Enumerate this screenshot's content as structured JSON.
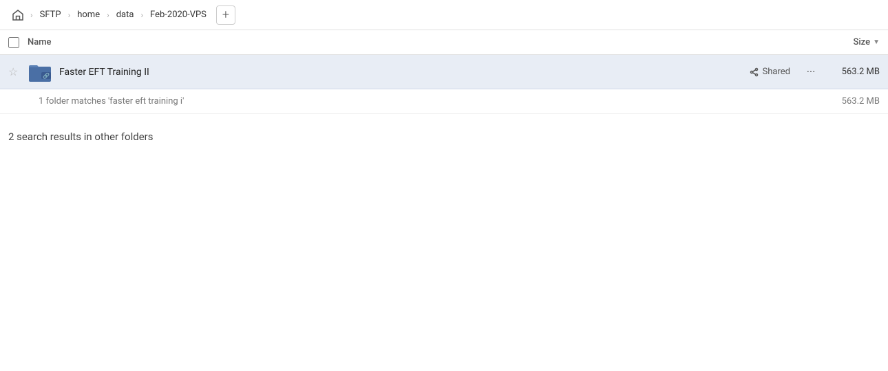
{
  "breadcrumb": {
    "home_icon": "home",
    "items": [
      {
        "label": "SFTP",
        "id": "sftp"
      },
      {
        "label": "home",
        "id": "home"
      },
      {
        "label": "data",
        "id": "data"
      },
      {
        "label": "Feb-2020-VPS",
        "id": "feb-2020-vps"
      }
    ],
    "add_label": "+"
  },
  "column_header": {
    "name_label": "Name",
    "size_label": "Size"
  },
  "file_row": {
    "name": "Faster EFT Training II",
    "shared_label": "Shared",
    "size": "563.2 MB",
    "starred": false,
    "more_icon": "···"
  },
  "info_row": {
    "text": "1 folder matches 'faster eft training i'",
    "size": "563.2 MB"
  },
  "other_results": {
    "text": "2 search results in other folders"
  }
}
